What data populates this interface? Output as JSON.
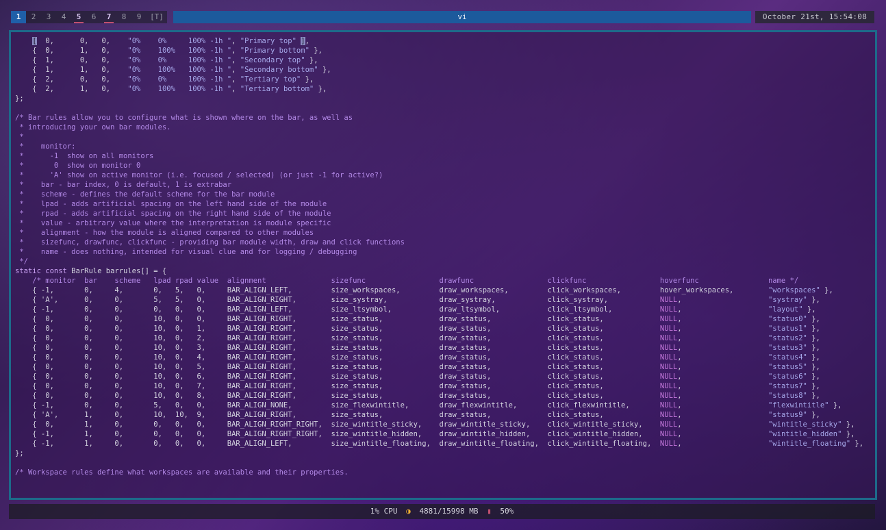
{
  "topbar": {
    "tags": [
      "1",
      "2",
      "3",
      "4",
      "5",
      "6",
      "7",
      "8",
      "9"
    ],
    "active_tag": "1",
    "occupied_tags": [
      "5",
      "7"
    ],
    "layout_symbol": "[T]",
    "window_title": "vi",
    "clock": "October 21st, 15:54:08"
  },
  "code_lines": [
    "    [  0,      0,   0,    \"0%    0%     100% -1h \", \"Primary top\" ],",
    "    {  0,      1,   0,    \"0%    100%   100% -1h \", \"Primary bottom\" },",
    "    {  1,      0,   0,    \"0%    0%     100% -1h \", \"Secondary top\" },",
    "    {  1,      1,   0,    \"0%    100%   100% -1h \", \"Secondary bottom\" },",
    "    {  2,      0,   0,    \"0%    0%     100% -1h \", \"Tertiary top\" },",
    "    {  2,      1,   0,    \"0%    100%   100% -1h \", \"Tertiary bottom\" },",
    "};",
    "",
    "/* Bar rules allow you to configure what is shown where on the bar, as well as",
    " * introducing your own bar modules.",
    " *",
    " *    monitor:",
    " *      -1  show on all monitors",
    " *       0  show on monitor 0",
    " *      'A' show on active monitor (i.e. focused / selected) (or just -1 for active?)",
    " *    bar - bar index, 0 is default, 1 is extrabar",
    " *    scheme - defines the default scheme for the bar module",
    " *    lpad - adds artificial spacing on the left hand side of the module",
    " *    rpad - adds artificial spacing on the right hand side of the module",
    " *    value - arbitrary value where the interpretation is module specific",
    " *    alignment - how the module is aligned compared to other modules",
    " *    sizefunc, drawfunc, clickfunc - providing bar module width, draw and click functions",
    " *    name - does nothing, intended for visual clue and for logging / debugging",
    " */",
    "static const BarRule barrules[] = {",
    "    /* monitor  bar    scheme   lpad rpad value  alignment               sizefunc                 drawfunc                 clickfunc                 hoverfunc                name */",
    "    { -1,       0,     4,       0,   5,   0,     BAR_ALIGN_LEFT,         size_workspaces,         draw_workspaces,         click_workspaces,         hover_workspaces,        \"workspaces\" },",
    "    { 'A',      0,     0,       5,   5,   0,     BAR_ALIGN_RIGHT,        size_systray,            draw_systray,            click_systray,            NULL,                    \"systray\" },",
    "    { -1,       0,     0,       0,   0,   0,     BAR_ALIGN_LEFT,         size_ltsymbol,           draw_ltsymbol,           click_ltsymbol,           NULL,                    \"layout\" },",
    "    {  0,       0,     0,       10,  0,   0,     BAR_ALIGN_RIGHT,        size_status,             draw_status,             click_status,             NULL,                    \"status0\" },",
    "    {  0,       0,     0,       10,  0,   1,     BAR_ALIGN_RIGHT,        size_status,             draw_status,             click_status,             NULL,                    \"status1\" },",
    "    {  0,       0,     0,       10,  0,   2,     BAR_ALIGN_RIGHT,        size_status,             draw_status,             click_status,             NULL,                    \"status2\" },",
    "    {  0,       0,     0,       10,  0,   3,     BAR_ALIGN_RIGHT,        size_status,             draw_status,             click_status,             NULL,                    \"status3\" },",
    "    {  0,       0,     0,       10,  0,   4,     BAR_ALIGN_RIGHT,        size_status,             draw_status,             click_status,             NULL,                    \"status4\" },",
    "    {  0,       0,     0,       10,  0,   5,     BAR_ALIGN_RIGHT,        size_status,             draw_status,             click_status,             NULL,                    \"status5\" },",
    "    {  0,       0,     0,       10,  0,   6,     BAR_ALIGN_RIGHT,        size_status,             draw_status,             click_status,             NULL,                    \"status6\" },",
    "    {  0,       0,     0,       10,  0,   7,     BAR_ALIGN_RIGHT,        size_status,             draw_status,             click_status,             NULL,                    \"status7\" },",
    "    {  0,       0,     0,       10,  0,   8,     BAR_ALIGN_RIGHT,        size_status,             draw_status,             click_status,             NULL,                    \"status8\" },",
    "    { -1,       0,     0,       5,   0,   0,     BAR_ALIGN_NONE,         size_flexwintitle,       draw_flexwintitle,       click_flexwintitle,       NULL,                    \"flexwintitle\" },",
    "    { 'A',      1,     0,       10,  10,  9,     BAR_ALIGN_RIGHT,        size_status,             draw_status,             click_status,             NULL,                    \"status9\" },",
    "    {  0,       1,     0,       0,   0,   0,     BAR_ALIGN_RIGHT_RIGHT,  size_wintitle_sticky,    draw_wintitle_sticky,    click_wintitle_sticky,    NULL,                    \"wintitle_sticky\" },",
    "    { -1,       1,     0,       0,   0,   0,     BAR_ALIGN_RIGHT_RIGHT,  size_wintitle_hidden,    draw_wintitle_hidden,    click_wintitle_hidden,    NULL,                    \"wintitle_hidden\" },",
    "    { -1,       1,     0,       0,   0,   0,     BAR_ALIGN_LEFT,         size_wintitle_floating,  draw_wintitle_floating,  click_wintitle_floating,  NULL,                    \"wintitle_floating\" },",
    "};",
    "",
    "/* Workspace rules define what workspaces are available and their properties."
  ],
  "bottombar": {
    "cpu": "1% CPU",
    "memory": "4881/15998 MB",
    "battery": "50%"
  },
  "colors": {
    "active_tag": "#1f5fa8",
    "title_bar": "#1c5a9c",
    "window_border": "#1d6a8a",
    "comment": "#b288e6",
    "string": "#a6a8ea"
  }
}
